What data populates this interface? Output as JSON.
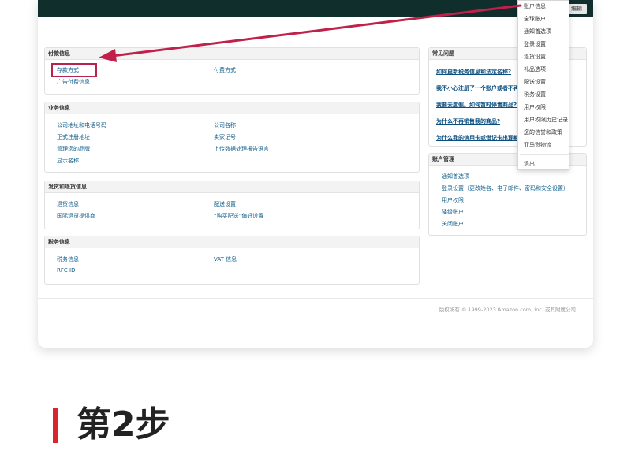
{
  "colors": {
    "topbar": "#0f2e2c",
    "link": "#0f5e8a",
    "arrow": "#c0204a",
    "step_accent": "#d7262e"
  },
  "header": {
    "edit_label": "编辑"
  },
  "payment_panel": {
    "title": "付款信息",
    "links": [
      "存款方式",
      "付费方式",
      "广告付费信息"
    ]
  },
  "business_panel": {
    "title": "业务信息",
    "links": [
      "公司地址和电话号码",
      "公司名称",
      "正式注册地址",
      "卖家记号",
      "管理您的品牌",
      "上传数据处理报告语言",
      "显示名称"
    ]
  },
  "shipping_panel": {
    "title": "发货和退货信息",
    "links": [
      "退货信息",
      "配送设置",
      "国际退货提供商",
      "“购买配送”偏好设置"
    ]
  },
  "tax_panel": {
    "title": "税务信息",
    "links": [
      "税务信息",
      "VAT 信息",
      "RFC ID"
    ]
  },
  "faq_panel": {
    "title": "常见问题",
    "items": [
      "如何更新税务信息和法定名称?",
      "我不小心注册了一个账户或者不再需要...?",
      "我要去度假。如何暂时停售商品?",
      "为什么不再销售我的商品?",
      "为什么我的信用卡或借记卡出现额外..."
    ]
  },
  "account_panel": {
    "title": "账户管理",
    "links": [
      "通知首选项",
      "登录设置（更改姓名、电子邮件、密码和安全设置）",
      "用户权限",
      "降级账户",
      "关闭账户"
    ]
  },
  "dropdown": {
    "items": [
      "账户信息",
      "全球账户",
      "通知首选项",
      "登录设置",
      "退货设置",
      "礼品选项",
      "配送设置",
      "税务设置",
      "用户权限",
      "用户权限历史记录",
      "您的信誉和政策",
      "亚马逊物流",
      "退出"
    ]
  },
  "footer": {
    "copyright": "版权所有 © 1999-2023 Amazon.com, Inc. 或其附属公司"
  },
  "step": {
    "title": "第2步"
  }
}
